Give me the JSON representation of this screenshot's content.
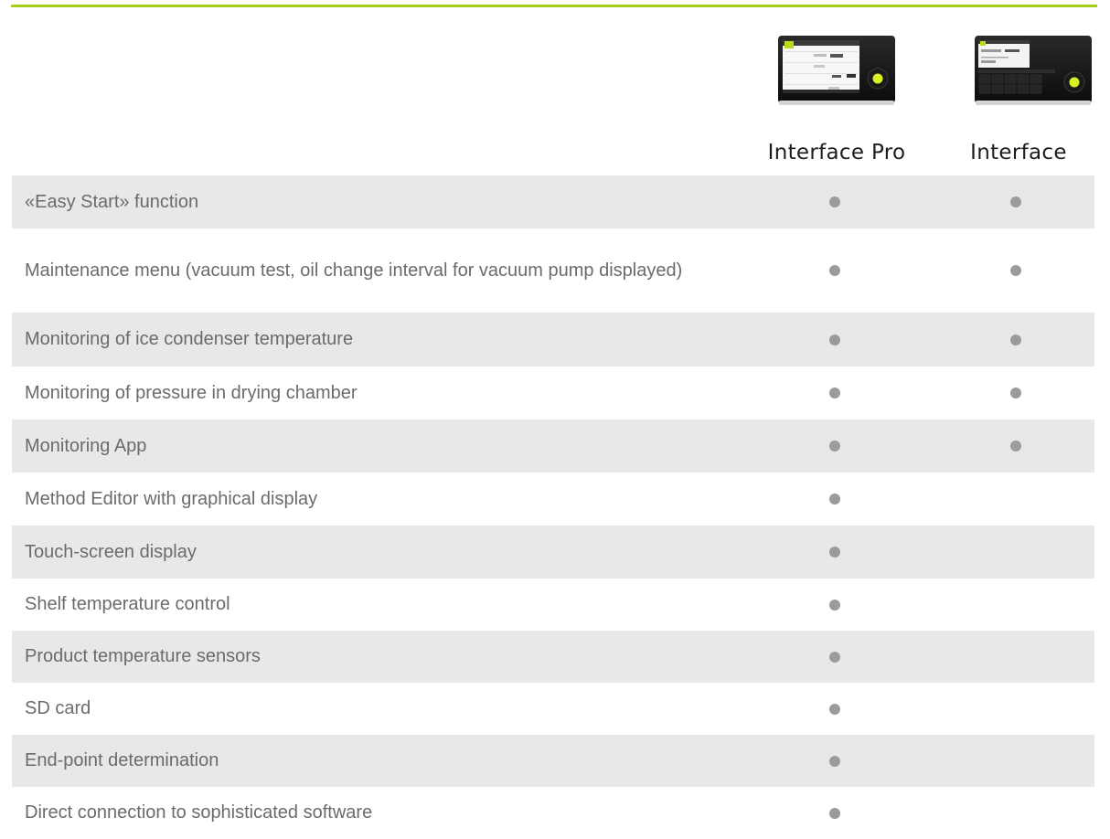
{
  "columns": {
    "pro": "Interface Pro",
    "basic": "Interface"
  },
  "colors": {
    "accent": "#a6cf1c",
    "row_shade": "#e8e8e9",
    "bullet": "#9b9b9b"
  },
  "rows": [
    {
      "label": "«Easy Start» function",
      "pro": true,
      "basic": true
    },
    {
      "label": "Maintenance menu (vacuum test, oil change interval for vacuum pump displayed)",
      "pro": true,
      "basic": true
    },
    {
      "label": "Monitoring of ice condenser temperature",
      "pro": true,
      "basic": true
    },
    {
      "label": "Monitoring of pressure in drying chamber",
      "pro": true,
      "basic": true
    },
    {
      "label": "Monitoring App",
      "pro": true,
      "basic": true
    },
    {
      "label": "Method Editor with graphical display",
      "pro": true,
      "basic": false
    },
    {
      "label": "Touch-screen display",
      "pro": true,
      "basic": false
    },
    {
      "label": "Shelf temperature control",
      "pro": true,
      "basic": false
    },
    {
      "label": "Product temperature sensors",
      "pro": true,
      "basic": false
    },
    {
      "label": "SD card",
      "pro": true,
      "basic": false
    },
    {
      "label": "End-point determination",
      "pro": true,
      "basic": false
    },
    {
      "label": "Direct connection to sophisticated software",
      "pro": true,
      "basic": false
    }
  ]
}
